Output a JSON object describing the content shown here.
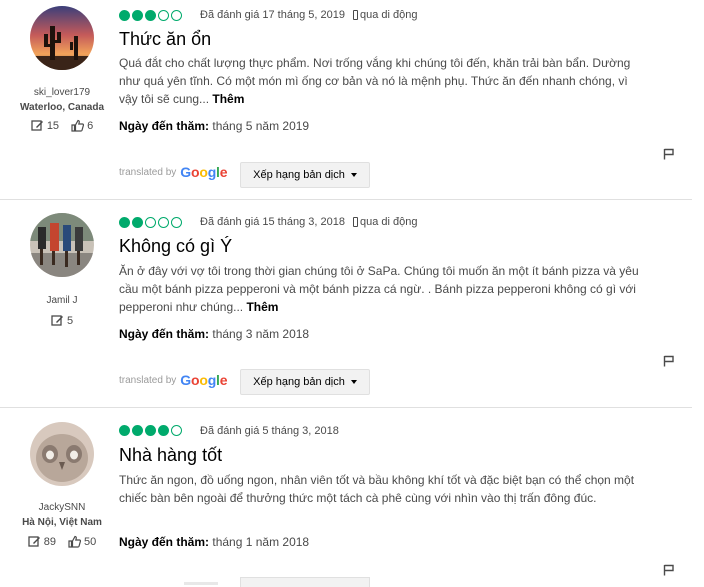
{
  "reviews": [
    {
      "username": "ski_lover179",
      "location": "Waterloo, Canada",
      "contributions": "15",
      "helpful": "6",
      "rating": 3,
      "rated_date": "Đã đánh giá 17 tháng 5, 2019",
      "via": "qua di động",
      "title": "Thức ăn ổn",
      "text": "Quá đắt cho chất lượng thực phẩm. Nơi trống vắng khi chúng tôi đến, khăn trải bàn bẩn. Dường như quá yên tĩnh. Có một món mì ống cơ bản và nó là mệnh phụ. Thức ăn đến nhanh chóng, vì vậy tôi sẽ cung...",
      "more": "Thêm",
      "visit_label": "Ngày đến thăm:",
      "visit_value": "tháng 5 năm 2019",
      "translated_by": "translated by",
      "rate_translation": "Xếp hạng bản dịch",
      "avatar_icon": "desert-cactus-sunset-photo"
    },
    {
      "username": "Jamil J",
      "location": "",
      "contributions": "5",
      "helpful": "",
      "rating": 2,
      "rated_date": "Đã đánh giá 15 tháng 3, 2018",
      "via": "qua di động",
      "title": "Không có gì Ý",
      "text": "Ăn ở đây với vợ tôi trong thời gian chúng tôi ở SaPa. Chúng tôi muốn ăn một ít bánh pizza và yêu cầu một bánh pizza pepperoni và một bánh pizza cá ngừ. . Bánh pizza pepperoni không có gì với pepperoni như chúng...",
      "more": "Thêm",
      "visit_label": "Ngày đến thăm:",
      "visit_value": "tháng 3 năm 2018",
      "translated_by": "translated by",
      "rate_translation": "Xếp hạng bản dịch",
      "avatar_icon": "runners-race-photo"
    },
    {
      "username": "JackySNN",
      "location": "Hà Nội, Việt Nam",
      "contributions": "89",
      "helpful": "50",
      "rating": 4,
      "rated_date": "Đã đánh giá 5 tháng 3, 2018",
      "via": "",
      "title": "Nhà hàng tốt",
      "text": "Thức ăn ngon, đồ uống ngon, nhân viên tốt và bầu không khí tốt và đặc biệt bạn có thể chọn một chiếc bàn bên ngoài để thưởng thức một tách cà phê cùng với nhìn vào thị trấn đông đúc.",
      "more": "",
      "visit_label": "Ngày đến thăm:",
      "visit_value": "tháng 1 năm 2018",
      "avatar_icon": "owl-face-photo"
    }
  ],
  "colors": {
    "bubble": "#00aa6c",
    "text": "#4a4a4a",
    "divider": "#e0e0e0"
  }
}
